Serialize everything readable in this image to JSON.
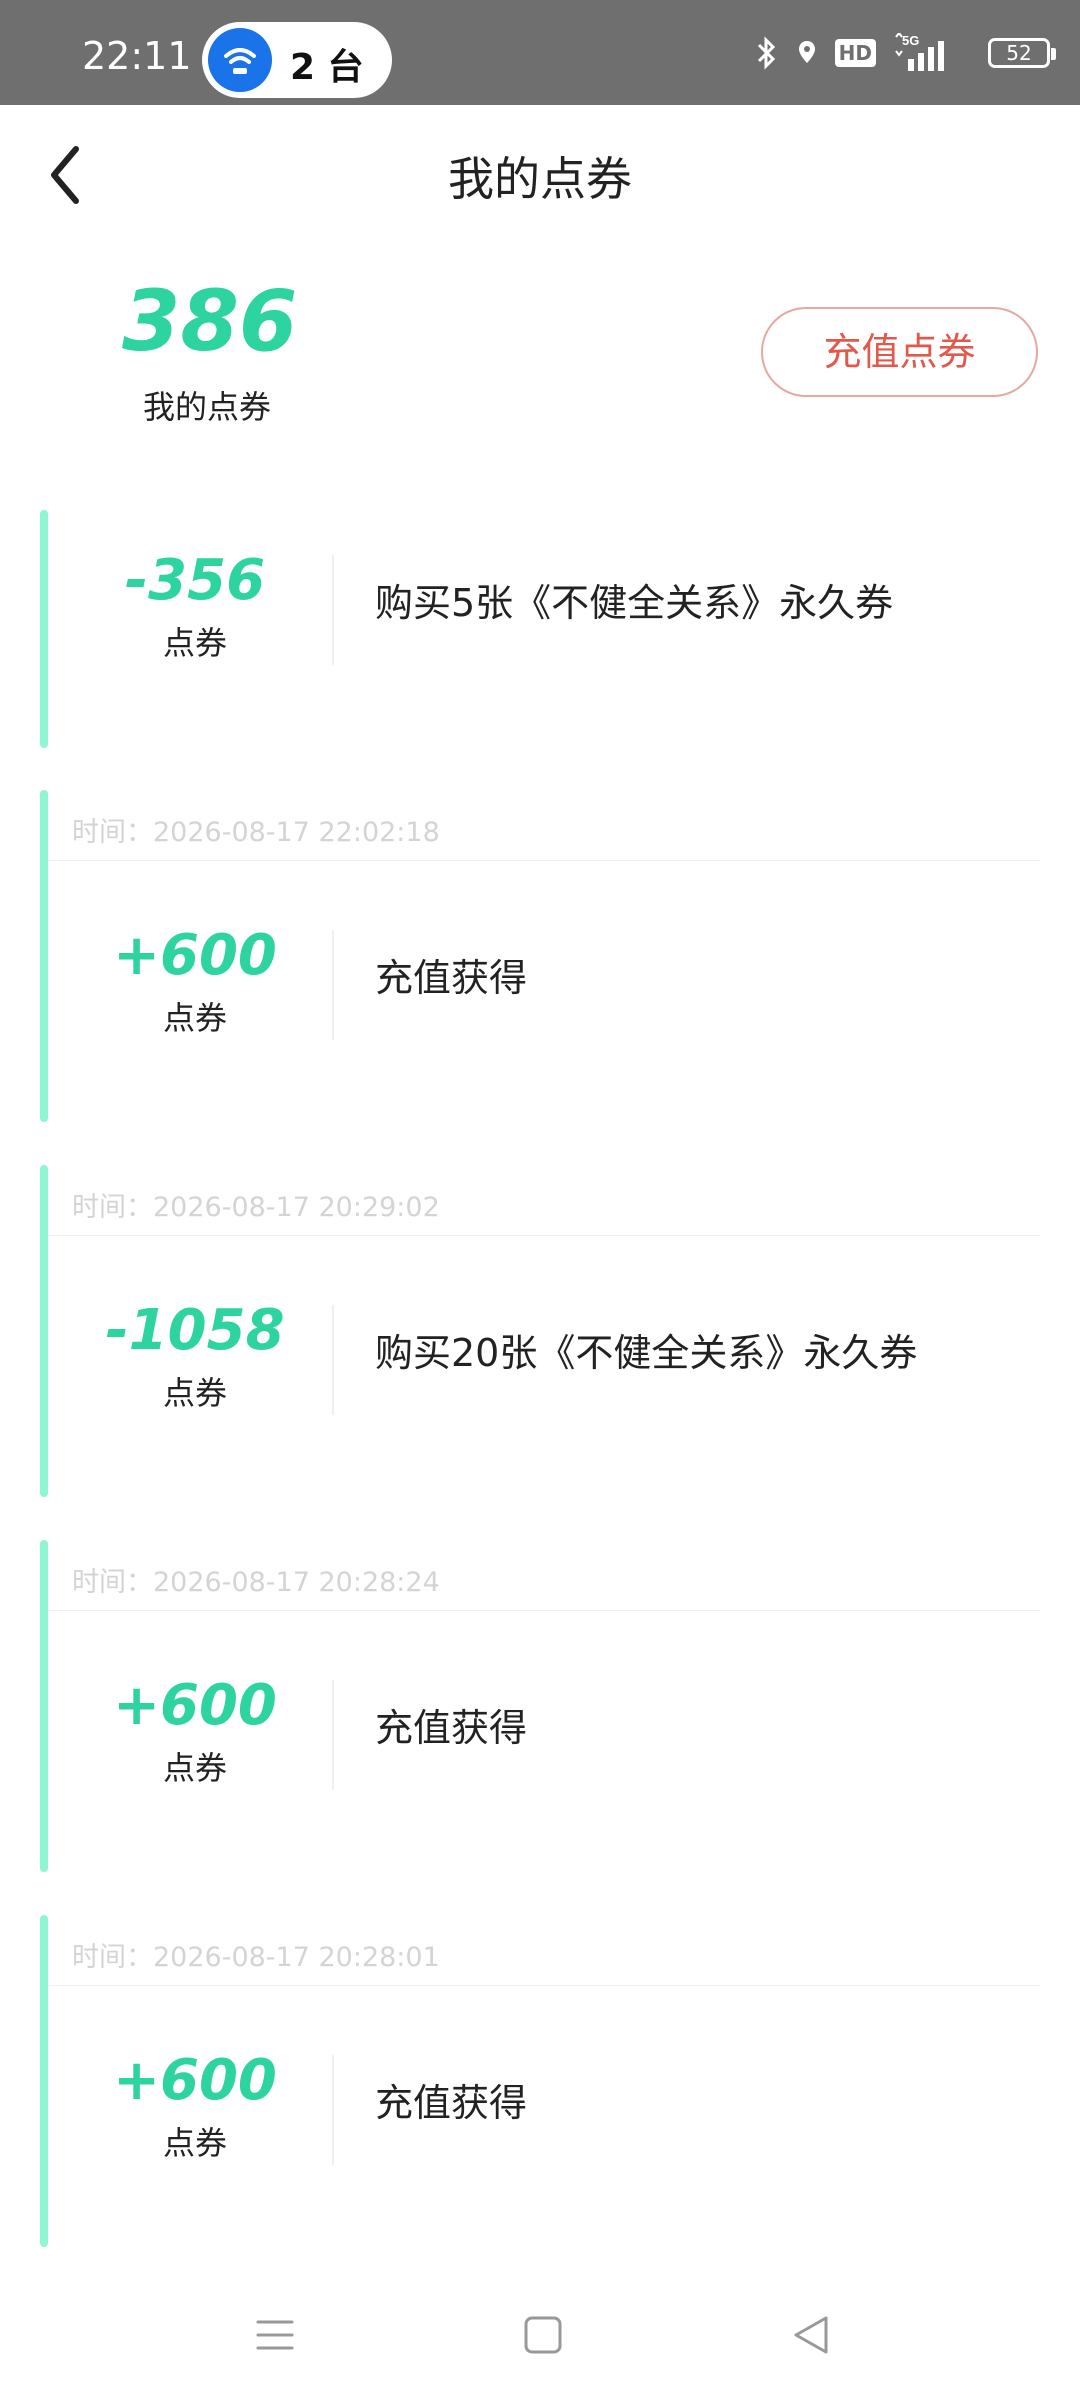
{
  "status_bar": {
    "time": "22:11",
    "pill_text": "2 台",
    "icons": [
      "wifi-icon",
      "bluetooth-icon",
      "location-icon",
      "hd-icon",
      "5g-signal-icon",
      "battery-icon"
    ],
    "hd_label": "HD",
    "network_label": "5G",
    "battery": "52"
  },
  "header": {
    "back_icon": "chevron-left-icon",
    "title": "我的点券"
  },
  "summary": {
    "balance": "386",
    "balance_label": "我的点券",
    "recharge_label": "充值点券"
  },
  "records": [
    {
      "time": "",
      "amount": "-356",
      "unit": "点券",
      "description": "购买5张《不健全关系》永久券"
    },
    {
      "time": "时间：2026-08-17 22:02:18",
      "amount": "+600",
      "unit": "点券",
      "description": "充值获得"
    },
    {
      "time": "时间：2026-08-17 20:29:02",
      "amount": "-1058",
      "unit": "点券",
      "description": "购买20张《不健全关系》永久券"
    },
    {
      "time": "时间：2026-08-17 20:28:24",
      "amount": "+600",
      "unit": "点券",
      "description": "充值获得"
    },
    {
      "time": "时间：2026-08-17 20:28:01",
      "amount": "+600",
      "unit": "点券",
      "description": "充值获得"
    }
  ],
  "nav_bar": {
    "icons": [
      "menu-icon",
      "home-icon",
      "back-triangle-icon"
    ]
  },
  "colors": {
    "accent_green": "#2dd4a0",
    "stripe_green": "#8ff5d2",
    "recharge_red": "#e0594a",
    "status_bar_bg": "#6f6f6f"
  }
}
